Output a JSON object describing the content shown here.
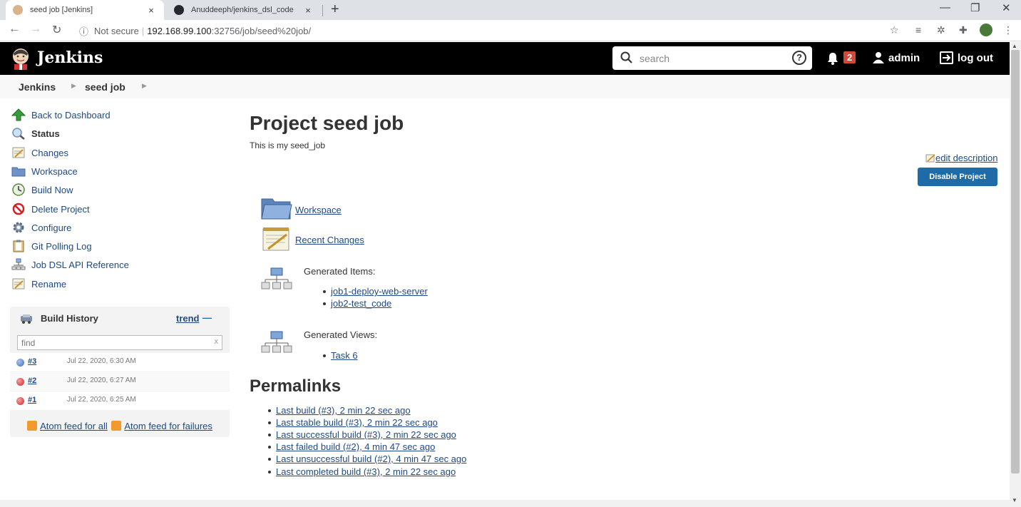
{
  "browser": {
    "tabs": [
      {
        "title": "seed job [Jenkins]",
        "close": "×"
      },
      {
        "title": "Anuddeeph/jenkins_dsl_code",
        "close": "×"
      }
    ],
    "new_tab": "+",
    "window_controls": {
      "minimize": "—",
      "restore": "❐",
      "close": "✕"
    },
    "security_label": "Not secure",
    "url_host": "192.168.99.100",
    "url_path": ":32756/job/seed%20job/"
  },
  "header": {
    "title": "Jenkins",
    "search_placeholder": "search",
    "help": "?",
    "notification_count": "2",
    "user": "admin",
    "logout": "log out"
  },
  "breadcrumb": [
    "Jenkins",
    "seed job"
  ],
  "sidebar": {
    "tasks": [
      {
        "label": "Back to Dashboard",
        "icon": "up-arrow-icon"
      },
      {
        "label": "Status",
        "icon": "magnifier-icon"
      },
      {
        "label": "Changes",
        "icon": "notepad-icon"
      },
      {
        "label": "Workspace",
        "icon": "folder-icon"
      },
      {
        "label": "Build Now",
        "icon": "clock-icon"
      },
      {
        "label": "Delete Project",
        "icon": "no-entry-icon"
      },
      {
        "label": "Configure",
        "icon": "gear-icon"
      },
      {
        "label": "Git Polling Log",
        "icon": "clipboard-icon"
      },
      {
        "label": "Job DSL API Reference",
        "icon": "network-icon"
      },
      {
        "label": "Rename",
        "icon": "notepad-icon"
      }
    ]
  },
  "build_history": {
    "title": "Build History",
    "trend": "trend",
    "trend_symbol": "—",
    "find_placeholder": "find",
    "clear": "x",
    "builds": [
      {
        "number": "#3",
        "date": "Jul 22, 2020, 6:30 AM",
        "status": "success",
        "color": "#3b6fc4"
      },
      {
        "number": "#2",
        "date": "Jul 22, 2020, 6:27 AM",
        "status": "failure",
        "color": "#d42020"
      },
      {
        "number": "#1",
        "date": "Jul 22, 2020, 6:25 AM",
        "status": "failure",
        "color": "#d42020"
      }
    ],
    "feed_all": "Atom feed for all",
    "feed_failures": "Atom feed for failures"
  },
  "main": {
    "title": "Project seed job",
    "description": "This is my seed_job",
    "edit_description": "edit description",
    "disable_button": "Disable Project",
    "workspace_link": "Workspace",
    "recent_changes_link": "Recent Changes",
    "generated_items_label": "Generated Items:",
    "generated_items": [
      "job1-deploy-web-server",
      "job2-test_code"
    ],
    "generated_views_label": "Generated Views:",
    "generated_views": [
      "Task 6"
    ]
  },
  "permalinks": {
    "title": "Permalinks",
    "items": [
      "Last build (#3), 2 min 22 sec ago",
      "Last stable build (#3), 2 min 22 sec ago",
      "Last successful build (#3), 2 min 22 sec ago",
      "Last failed build (#2), 4 min 47 sec ago",
      "Last unsuccessful build (#2), 4 min 47 sec ago",
      "Last completed build (#3), 2 min 22 sec ago"
    ]
  },
  "colors": {
    "link": "#204a87",
    "header_bg": "#000000",
    "badge": "#d24939",
    "disable_button": "#1f6ba7"
  }
}
